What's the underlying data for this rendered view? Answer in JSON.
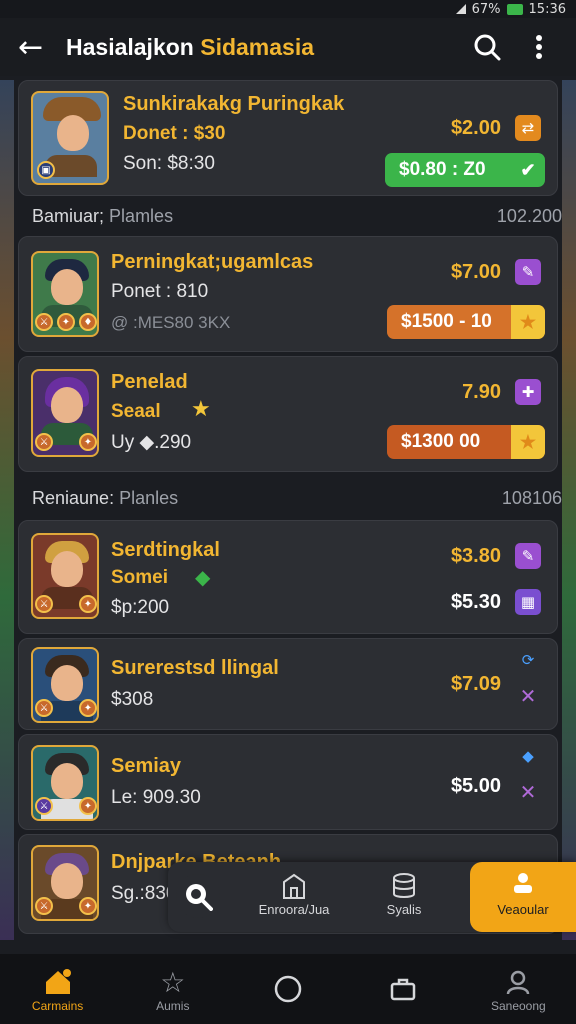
{
  "status": {
    "battery": "67%",
    "time": "15:36"
  },
  "header": {
    "title_main": "Hasialajkon",
    "title_accent": "Sidamasia"
  },
  "featured": {
    "name": "Sunkirakakg Puringkak",
    "line1": "Donet : $30",
    "line2": "Son: $8:30",
    "price": "$2.00",
    "action": "$0.80 : Z0"
  },
  "section1": {
    "label_bold": "Bamiuar;",
    "label_rest": "Plamles",
    "count": "102.200",
    "items": [
      {
        "name": "Perningkat;ugamlcas",
        "line1": "Ponet : 810",
        "line2": "@ :MES80 3KX",
        "price": "$7.00",
        "action": "$1500 - 10"
      },
      {
        "name": "Penelad",
        "line1": "Seaal",
        "line2": "Uy ◆.290",
        "price": "7.90",
        "action": "$1300 00"
      }
    ]
  },
  "section2": {
    "label_bold": "Reniaune:",
    "label_rest": "Planles",
    "count": "108106",
    "items": [
      {
        "name": "Serdtingkal",
        "line1": "Somei",
        "line2": "$p:200",
        "price": "$3.80",
        "price2": "$5.30"
      },
      {
        "name": "Surerestsd llingal",
        "line1": "$308",
        "price": "$7.09"
      },
      {
        "name": "Semiay",
        "line1": "Le: 909.30",
        "price": "$5.00"
      },
      {
        "name": "Dnjparke Beteanh",
        "line1": "Sg.:830"
      }
    ]
  },
  "float_bar": {
    "items": [
      {
        "label": "Enroora/Jua"
      },
      {
        "label": "Syalis"
      }
    ],
    "active_label": "Veaoular"
  },
  "bottom_nav": [
    {
      "label": "Carmains"
    },
    {
      "label": "Aumis"
    },
    {
      "label": ""
    },
    {
      "label": ""
    },
    {
      "label": "Saneoong"
    }
  ],
  "colors": {
    "accent": "#f2b632",
    "green": "#3bb54a",
    "orange": "#d5722a",
    "bg": "#1b1d22"
  }
}
